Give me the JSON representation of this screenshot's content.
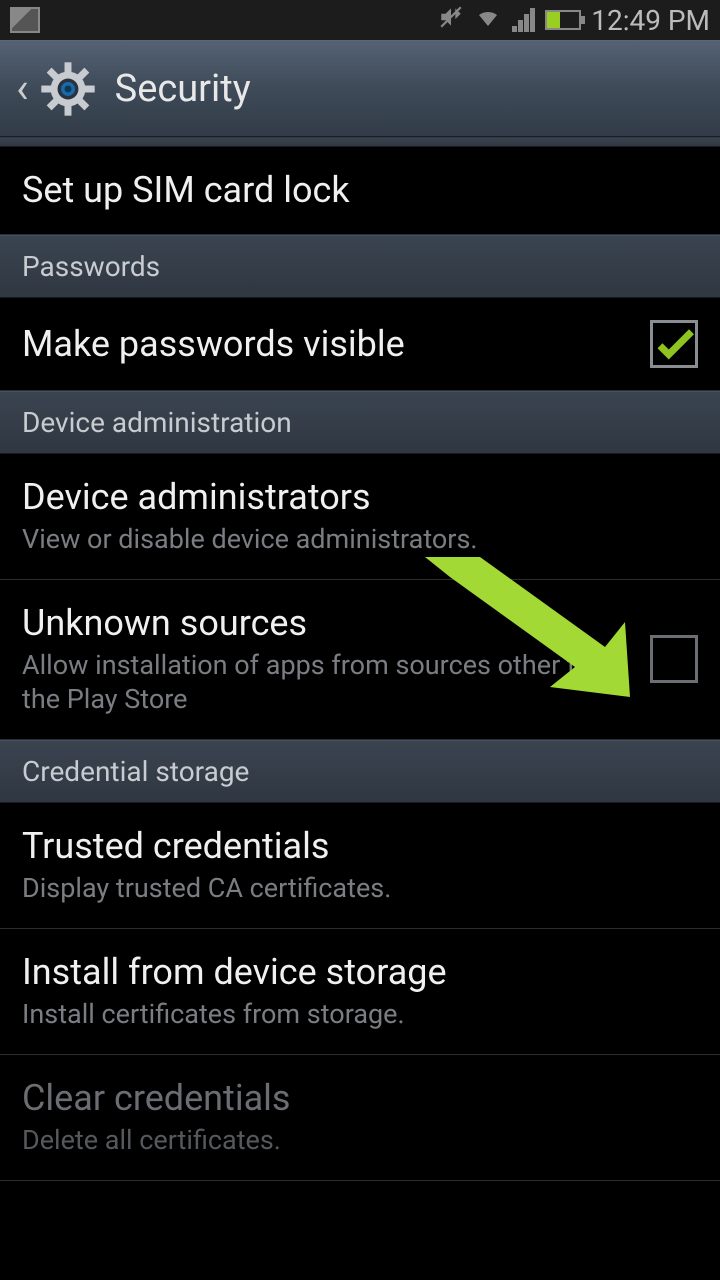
{
  "status": {
    "time": "12:49 PM"
  },
  "header": {
    "title": "Security"
  },
  "sections": {
    "sim": {
      "label": "Set up SIM card lock"
    },
    "passwords_header": "Passwords",
    "passwords_visible": {
      "label": "Make passwords visible",
      "checked": true
    },
    "device_admin_header": "Device administration",
    "device_admins": {
      "label": "Device administrators",
      "sub": "View or disable device administrators."
    },
    "unknown_sources": {
      "label": "Unknown sources",
      "sub": "Allow installation of apps from sources other than the Play Store",
      "checked": false
    },
    "credential_header": "Credential storage",
    "trusted": {
      "label": "Trusted credentials",
      "sub": "Display trusted CA certificates."
    },
    "install_storage": {
      "label": "Install from device storage",
      "sub": "Install certificates from storage."
    },
    "clear": {
      "label": "Clear credentials",
      "sub": "Delete all certificates.",
      "disabled": true
    }
  }
}
